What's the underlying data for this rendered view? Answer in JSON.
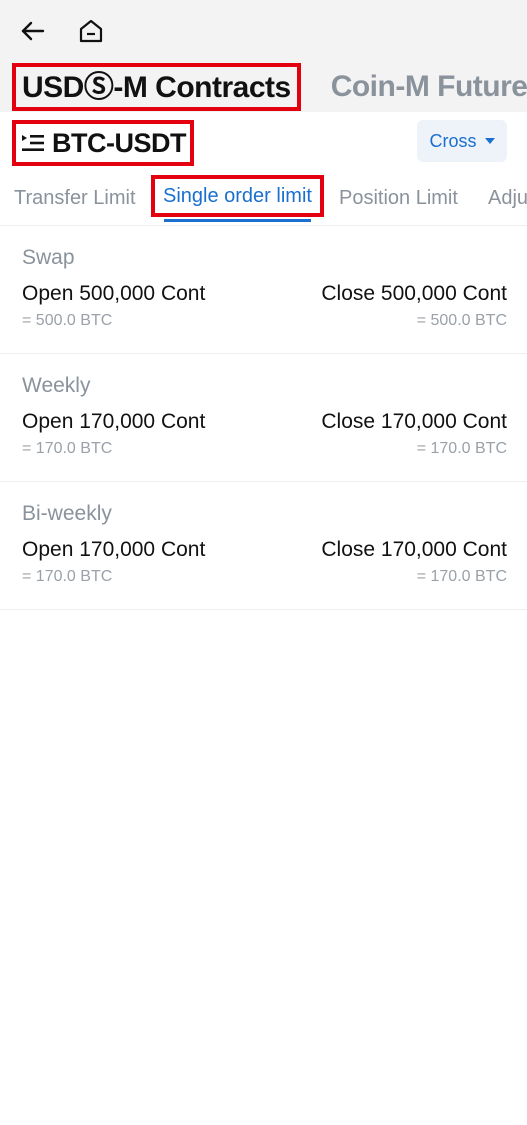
{
  "nav": {
    "back_icon": "arrow-left-icon",
    "home_icon": "home-icon"
  },
  "market_tabs": [
    {
      "label": "USDⓈ-M Contracts",
      "active": true
    },
    {
      "label": "Coin-M Futures",
      "active": false
    }
  ],
  "symbol": {
    "icon": "menu-indent-icon",
    "label": "BTC-USDT"
  },
  "margin_mode": {
    "label": "Cross",
    "icon": "caret-down-icon"
  },
  "limit_tabs": [
    {
      "label": "Transfer Limit",
      "active": false
    },
    {
      "label": "Single order limit",
      "active": true
    },
    {
      "label": "Position Limit",
      "active": false
    },
    {
      "label": "Adju",
      "active": false
    }
  ],
  "sections": [
    {
      "title": "Swap",
      "open": "Open 500,000 Cont",
      "open_sub": "= 500.0 BTC",
      "close": "Close 500,000 Cont",
      "close_sub": "= 500.0 BTC"
    },
    {
      "title": "Weekly",
      "open": "Open 170,000 Cont",
      "open_sub": "= 170.0 BTC",
      "close": "Close 170,000 Cont",
      "close_sub": "= 170.0 BTC"
    },
    {
      "title": "Bi-weekly",
      "open": "Open 170,000 Cont",
      "open_sub": "= 170.0 BTC",
      "close": "Close 170,000 Cont",
      "close_sub": "= 170.0 BTC"
    }
  ],
  "colors": {
    "accent": "#1a6fcf",
    "highlight_box": "#e3000f",
    "muted_text": "#8a929c"
  }
}
